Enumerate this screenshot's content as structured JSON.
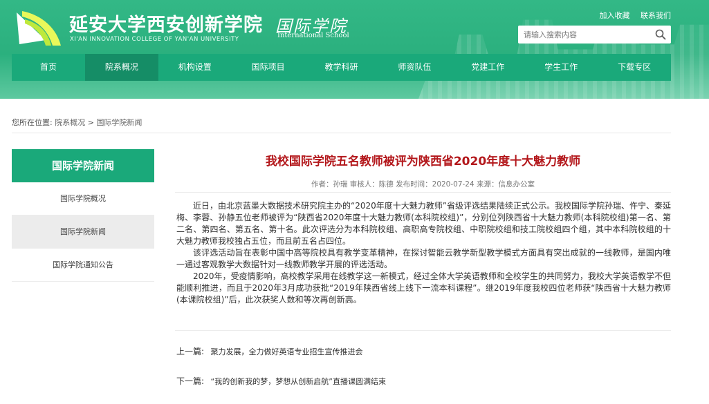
{
  "header": {
    "site_name": "延安大学西安创新学院",
    "site_name_en": "XI'AN INNOVATION COLLEGE OF YAN'AN UNIVERSITY",
    "sub_name": "国际学院",
    "sub_name_en": "International School",
    "toplinks": [
      "加入收藏",
      "联系我们"
    ],
    "search": {
      "placeholder": "请输入搜索内容",
      "icon": "search-icon"
    }
  },
  "nav": {
    "items": [
      "首页",
      "院系概况",
      "机构设置",
      "国际项目",
      "教学科研",
      "师资队伍",
      "党建工作",
      "学生工作",
      "下载专区"
    ],
    "active_index": 1
  },
  "breadcrumb": {
    "prefix": "您所在位置:",
    "items": [
      "院系概况",
      "国际学院新闻"
    ],
    "separator": ">"
  },
  "sidebar": {
    "heading": "国际学院新闻",
    "items": [
      "国际学院概况",
      "国际学院新闻",
      "国际学院通知公告"
    ],
    "active_index": 1
  },
  "article": {
    "title": "我校国际学院五名教师被评为陕西省2020年度十大魅力教师",
    "meta": "作者：孙瑞  审核人：陈德  发布时间：2020-07-24  来源：信息办公室",
    "paragraphs": [
      "近日，由北京蓝墨大数据技术研究院主办的“2020年度十大魅力教师”省级评选结果陆续正式公示。我校国际学院孙瑞、仵宁、秦延梅、李蓉、孙静五位老师被评为“陕西省2020年度十大魅力教师(本科院校组)”，分别位列陕西省十大魅力教师(本科院校组)第一名、第二名、第四名、第五名、第十名。此次评选分为本科院校组、高职高专院校组、中职院校组和技工院校组四个组，其中本科院校组的十大魅力教师我校独占五位，而且前五名占四位。",
      "该评选活动旨在表彰中国中高等院校具有教学变革精神，在探讨智能云教学新型教学模式方面具有突出成就的一线教师，是国内唯一通过客观教学大数据针对一线教师教学开展的评选活动。",
      "2020年，受疫情影响，高校教学采用在线教学这一新模式，经过全体大学英语教师和全校学生的共同努力，我校大学英语教学不但能顺利推进，而且于2020年3月成功获批“2019年陕西省线上线下一流本科课程”。继2019年度我校四位老师获“陕西省十大魅力教师(本课院校组)”后，此次获奖人数和等次再创新高。"
    ],
    "prev_label": "上一篇:",
    "prev_title": "聚力发展，全力做好英语专业招生宣传推进会",
    "next_label": "下一篇:",
    "next_title": "“我的创新我的梦，梦想从创新启航”直播课圆满结束"
  },
  "colors": {
    "header_green": "#2bb07e",
    "nav_green": "#1aa97a",
    "nav_active": "#158d66",
    "title_red": "#b3171b"
  }
}
